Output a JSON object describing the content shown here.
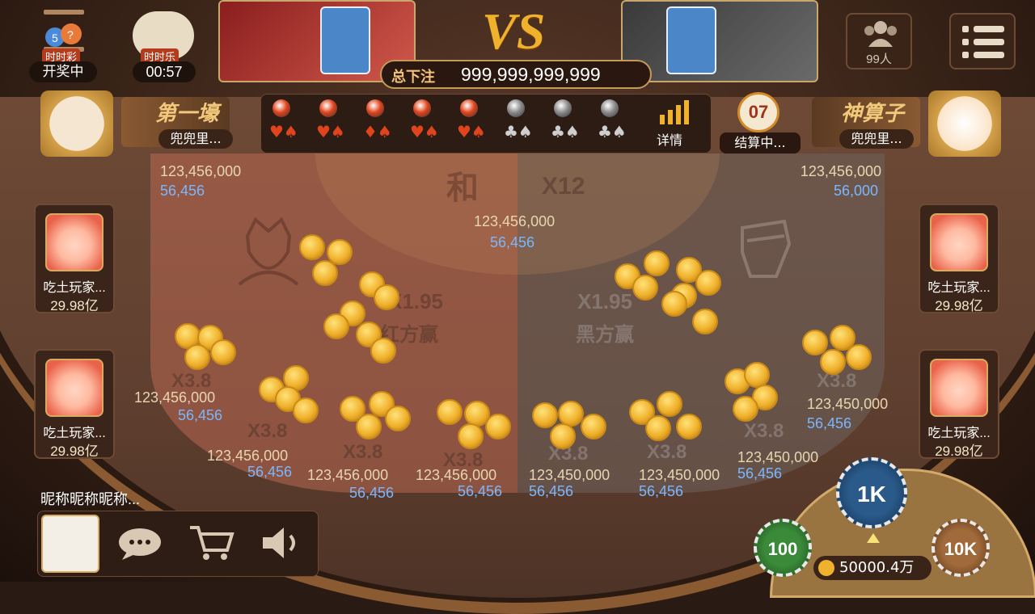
{
  "lottery": {
    "icon": "lottery-balls-icon",
    "badge": "时时彩",
    "status": "开奖中"
  },
  "poker": {
    "icon": "poker-cards-icon",
    "badge": "时时乐",
    "timer": "00:57"
  },
  "vs_text": "VS",
  "total_bet": {
    "label": "总下注",
    "value": "999,999,999,999"
  },
  "online": {
    "icon": "people-icon",
    "count": "99人"
  },
  "menu": {
    "icon": "menu-icon"
  },
  "left_rank": {
    "title": "第一壕",
    "name": "兜兜里..."
  },
  "right_rank": {
    "title": "神算子",
    "name": "兜兜里..."
  },
  "road": {
    "results": [
      {
        "color": "#e0441c",
        "suits": "♥♠"
      },
      {
        "color": "#e0441c",
        "suits": "♥♠"
      },
      {
        "color": "#e0441c",
        "suits": "♦♠"
      },
      {
        "color": "#e0441c",
        "suits": "♥♠"
      },
      {
        "color": "#e0441c",
        "suits": "♥♠"
      },
      {
        "color": "#8a8a8a",
        "suits": "♣♠"
      },
      {
        "color": "#8a8a8a",
        "suits": "♣♠"
      },
      {
        "color": "#8a8a8a",
        "suits": "♣♠"
      }
    ],
    "details_label": "详情"
  },
  "clock": {
    "value": "07",
    "status": "结算中..."
  },
  "board": {
    "tie": {
      "label": "和",
      "multiplier": "X12",
      "total": "123,456,000",
      "mine": "56,456"
    },
    "red": {
      "label": "红方赢",
      "multiplier": "X1.95",
      "total": "123,456,000",
      "mine": "56,456"
    },
    "black": {
      "label": "黑方赢",
      "multiplier": "X1.95",
      "total": "123,456,000",
      "mine": "56,000"
    },
    "side": [
      {
        "multiplier": "X3.8",
        "total": "123,456,000",
        "mine": "56,456"
      },
      {
        "multiplier": "X3.8",
        "total": "123,456,000",
        "mine": "56,456"
      },
      {
        "multiplier": "X3.8",
        "total": "123,456,000",
        "mine": "56,456"
      },
      {
        "multiplier": "X3.8",
        "total": "123,456,000",
        "mine": "56,456"
      },
      {
        "multiplier": "X3.8",
        "total": "123,450,000",
        "mine": "56,456"
      },
      {
        "multiplier": "X3.8",
        "total": "123,450,000",
        "mine": "56,456"
      },
      {
        "multiplier": "X3.8",
        "total": "123,450,000",
        "mine": "56,456"
      },
      {
        "multiplier": "X3.8",
        "total": "123,450,000",
        "mine": "56,456"
      }
    ]
  },
  "seats": [
    {
      "name": "吃土玩家...",
      "gold": "29.98亿"
    },
    {
      "name": "吃土玩家...",
      "gold": "29.98亿"
    },
    {
      "name": "吃土玩家...",
      "gold": "29.98亿"
    },
    {
      "name": "吃土玩家...",
      "gold": "29.98亿"
    }
  ],
  "me": {
    "nickname": "昵称昵称昵称...",
    "balance": "50000.4万"
  },
  "toolbar": {
    "chat_icon": "chat-icon",
    "shop_icon": "cart-icon",
    "sound_icon": "speaker-icon"
  },
  "chips": {
    "c100": "100",
    "c1k": "1K",
    "c10k": "10K"
  },
  "colors": {
    "red_side": "#b86852",
    "black_side": "#6e6058",
    "gold": "#f0b12c",
    "blue_text": "#7ab7ff"
  }
}
